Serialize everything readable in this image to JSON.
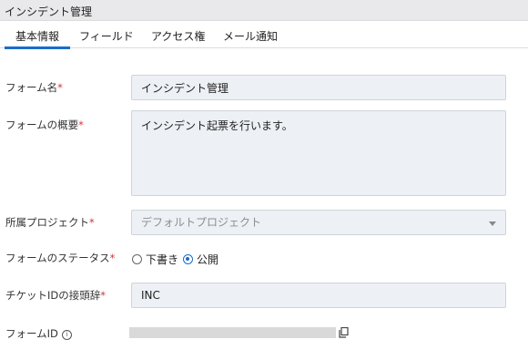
{
  "window": {
    "title": "インシデント管理"
  },
  "tabs": [
    {
      "label": "基本情報",
      "active": true
    },
    {
      "label": "フィールド",
      "active": false
    },
    {
      "label": "アクセス権",
      "active": false
    },
    {
      "label": "メール通知",
      "active": false
    }
  ],
  "form": {
    "name": {
      "label": "フォーム名",
      "required_mark": "*",
      "value": "インシデント管理"
    },
    "overview": {
      "label": "フォームの概要",
      "required_mark": "*",
      "value": "インシデント起票を行います。"
    },
    "project": {
      "label": "所属プロジェクト",
      "required_mark": "*",
      "placeholder": "デフォルトプロジェクト"
    },
    "status": {
      "label": "フォームのステータス",
      "required_mark": "*",
      "options": [
        {
          "label": "下書き",
          "checked": false
        },
        {
          "label": "公開",
          "checked": true
        }
      ]
    },
    "ticket_prefix": {
      "label": "チケットIDの接頭辞",
      "required_mark": "*",
      "value": "INC"
    },
    "form_id": {
      "label": "フォームID",
      "info_icon": "info-icon",
      "copy_icon": "copy-icon"
    }
  },
  "colors": {
    "accent": "#1a6ccc",
    "required": "#d23434",
    "field_bg": "#edf0f4"
  }
}
